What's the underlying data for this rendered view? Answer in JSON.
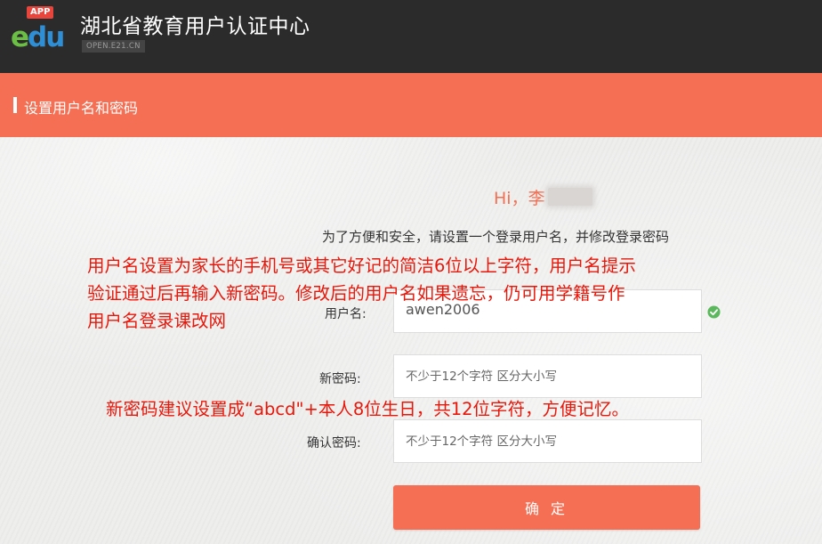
{
  "header": {
    "logo": {
      "badge": "APP",
      "letters": [
        "e",
        "d",
        "u"
      ],
      "colors": {
        "badge": "#e8453c",
        "e": "#6cbf45",
        "du": "#2f8fd6"
      }
    },
    "title": "湖北省教育用户认证中心",
    "domain": "OPEN.E21.CN",
    "background": "#2b2b2b"
  },
  "section": {
    "title": "设置用户名和密码",
    "accent": "#f46f53"
  },
  "greeting": {
    "text": "Hi，李"
  },
  "intro": "为了方便和安全，请设置一个登录用户名，并修改登录密码",
  "annotations": {
    "note_username": [
      "用户名设置为家长的手机号或其它好记的简洁6位以上字符，用户名提示",
      "验证通过后再输入新密码。修改后的用户名如果遗忘，仍可用学籍号作",
      "用户名登录课改网"
    ],
    "note_password": "新密码建议设置成“abcd\"+本人8位生日，共12位字符，方便记忆。",
    "color": "#e8170a"
  },
  "form": {
    "username": {
      "label": "用户名:",
      "value": "awen2006",
      "status_icon": "check-circle-icon",
      "status_color": "#5cb85c"
    },
    "new_password": {
      "label": "新密码:",
      "placeholder": "不少于12个字符 区分大小写"
    },
    "confirm_password": {
      "label": "确认密码:",
      "placeholder": "不少于12个字符 区分大小写"
    },
    "submit_label": "确 定"
  }
}
